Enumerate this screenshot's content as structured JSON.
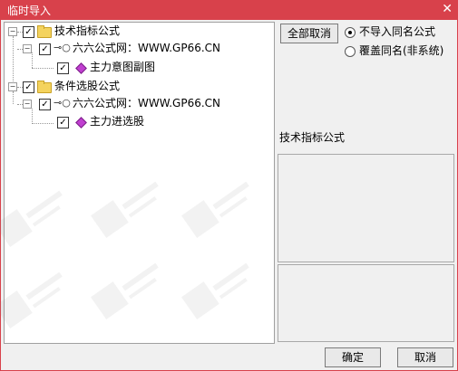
{
  "window": {
    "title": "临时导入",
    "close_label": "✕"
  },
  "tree": {
    "groups": [
      {
        "label": "技术指标公式",
        "checked": true,
        "source": {
          "label": "六六公式网：WWW.GP66.CN",
          "checked": true,
          "formula": {
            "label": "主力意图副图",
            "checked": true
          }
        }
      },
      {
        "label": "条件选股公式",
        "checked": true,
        "source": {
          "label": "六六公式网：WWW.GP66.CN",
          "checked": true,
          "formula": {
            "label": "主力进选股",
            "checked": true
          }
        }
      }
    ]
  },
  "controls": {
    "deselect_all_label": "全部取消",
    "options": [
      {
        "label": "不导入同名公式",
        "selected": true
      },
      {
        "label": "覆盖同名(非系统)",
        "selected": false
      }
    ]
  },
  "details": {
    "section_label": "技术指标公式"
  },
  "footer": {
    "ok_label": "确定",
    "cancel_label": "取消"
  },
  "colors": {
    "titlebar": "#d8414b",
    "formula_icon": "#c03fd0"
  }
}
